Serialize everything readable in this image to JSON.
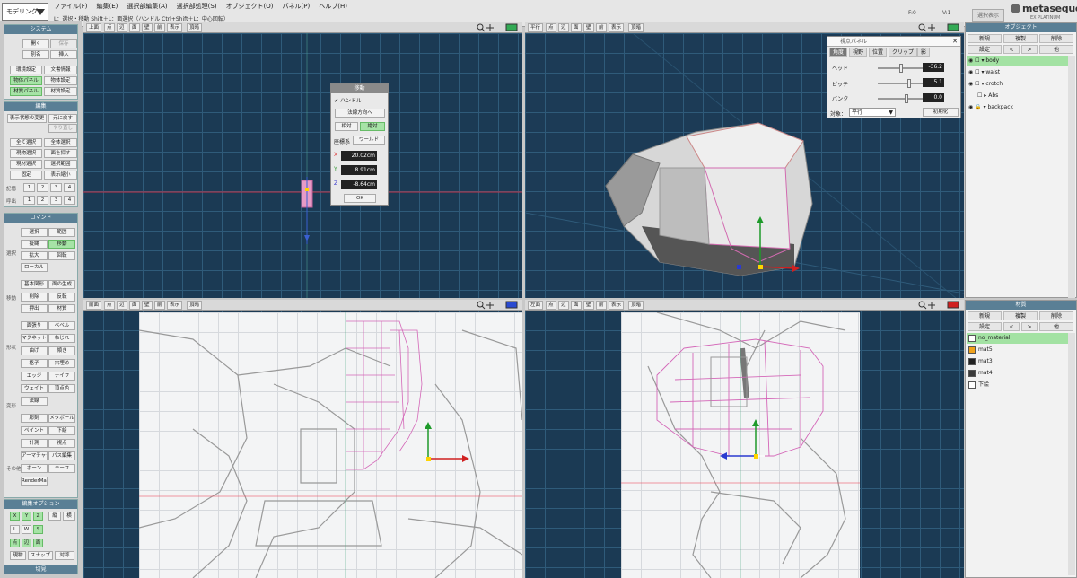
{
  "app": {
    "mode": "モデリング",
    "menus": [
      "ファイル(F)",
      "編集(E)",
      "選択部編集(A)",
      "選択部処理(S)",
      "オブジェクト(O)",
      "パネル(P)",
      "ヘルプ(H)"
    ],
    "hint": "L：選択・移動 Shift＋L：面選択（ハンドル Ctrl+Shift＋L：中心回転）",
    "stat_f": "F:0",
    "stat_v": "V:1",
    "sel_display": "選択表示",
    "logo": "metasequoia",
    "logo_num": "4",
    "logo_sub": "EX PLATINUM"
  },
  "left": {
    "system": {
      "title": "システム",
      "buttons": [
        "開く",
        "保存",
        "別名",
        "挿入",
        "環境設定",
        "文書情報",
        "物体パネル",
        "物体設定",
        "材質パネル",
        "材質設定"
      ]
    },
    "edit": {
      "title": "編集",
      "buttons": [
        "表示状態の変更",
        "元に戻す",
        "やり直し",
        "全て選択",
        "全体選択",
        "現物選択",
        "面を探す",
        "現材選択",
        "選択範囲",
        "固定",
        "表示縮小"
      ],
      "vlabels": [
        "記憶",
        "呼出"
      ],
      "nums": [
        "1",
        "2",
        "3",
        "4"
      ]
    },
    "command": {
      "title": "コマンド",
      "buttons": [
        "選択",
        "範囲",
        "投縄",
        "移動",
        "拡大",
        "回転",
        "ローカル",
        "基本図形",
        "面の生成",
        "削除",
        "反転",
        "押出",
        "材質",
        "面張り",
        "ベベル",
        "マグネット",
        "ねじれ",
        "曲げ",
        "傾き",
        "格子",
        "穴埋め",
        "エッジ",
        "ナイフ",
        "ウェイト",
        "頂点色",
        "法線",
        "彫刻",
        "メタボール",
        "ペイント",
        "下絵",
        "計測",
        "視点",
        "アーマチャー",
        "パス編集",
        "ボーン",
        "モーフ",
        "RenderMan"
      ],
      "vlabels": [
        "選択",
        "移動",
        "形状",
        "変形",
        "その他"
      ]
    },
    "options": {
      "title": "編集オプション",
      "xyz": [
        "X",
        "Y",
        "Z"
      ],
      "rows": [
        "縦",
        "横"
      ],
      "lws": [
        "L",
        "W",
        "S"
      ],
      "pts": [
        "点",
        "辺",
        "面"
      ],
      "snaps": [
        "現物",
        "スナップ",
        "対称"
      ],
      "bottom": "切見"
    }
  },
  "viewports": {
    "tl": {
      "label": "上面",
      "buttons": [
        "点",
        "辺",
        "面",
        "壁",
        "前",
        "表示",
        "頂暗"
      ]
    },
    "tr": {
      "label": "平行",
      "buttons": [
        "点",
        "辺",
        "面",
        "壁",
        "前",
        "表示",
        "頂暗"
      ]
    },
    "bl": {
      "label": "前面",
      "buttons": [
        "点",
        "辺",
        "面",
        "壁",
        "前",
        "表示",
        "頂暗"
      ]
    },
    "br": {
      "label": "左面",
      "buttons": [
        "点",
        "辺",
        "面",
        "壁",
        "前",
        "表示",
        "頂暗"
      ]
    }
  },
  "move_dialog": {
    "title": "移動",
    "handle": "ハンドル",
    "normal": "法線方向へ",
    "rel": "相対",
    "abs": "絶対",
    "coord": "座標系",
    "world": "ワールド",
    "x_label": "X",
    "x": "20.02cm",
    "y_label": "Y",
    "y": "8.91cm",
    "z_label": "Z",
    "z": "-8.64cm",
    "ok": "OK"
  },
  "view_panel": {
    "title": "視点パネル",
    "tabs": [
      "角度",
      "視野",
      "位置",
      "クリップ",
      "影"
    ],
    "head": "ヘッド",
    "head_val": "-36.2",
    "pitch": "ピッチ",
    "pitch_val": "5.1",
    "bank": "バンク",
    "bank_val": "0.0",
    "target_label": "対象：",
    "target": "平行",
    "reset": "初期化"
  },
  "objects": {
    "title": "オブジェクト",
    "btn1": [
      "新規",
      "複製",
      "削除"
    ],
    "btn2": [
      "設定",
      "<",
      ">",
      "他"
    ],
    "items": [
      {
        "name": "body",
        "selected": true
      },
      {
        "name": "waist",
        "selected": false
      },
      {
        "name": "crotch",
        "selected": false
      },
      {
        "name": "Abs",
        "selected": false
      },
      {
        "name": "backpack",
        "selected": false
      }
    ]
  },
  "materials": {
    "title": "材質",
    "btn1": [
      "新規",
      "複製",
      "削除"
    ],
    "btn2": [
      "設定",
      "<",
      ">",
      "他"
    ],
    "items": [
      {
        "name": "no_material",
        "color": "#ffffff",
        "selected": true
      },
      {
        "name": "mat5",
        "color": "#f0a21c",
        "selected": false
      },
      {
        "name": "mat3",
        "color": "#222222",
        "selected": false
      },
      {
        "name": "mat4",
        "color": "#3a3a3a",
        "selected": false
      },
      {
        "name": "下絵",
        "color": "#ffffff",
        "selected": false
      }
    ]
  }
}
